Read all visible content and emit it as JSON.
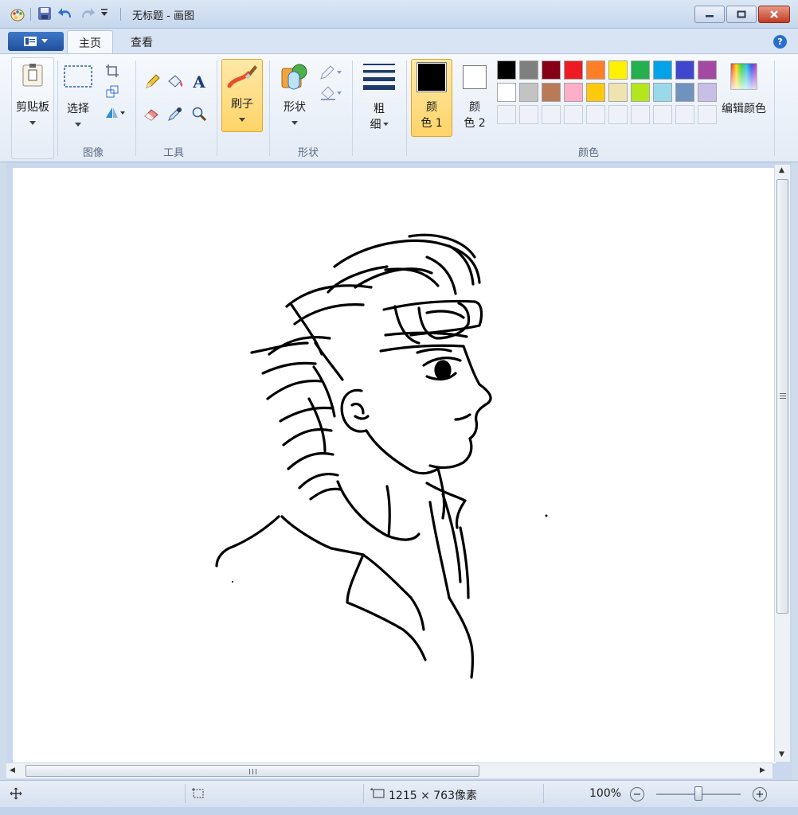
{
  "window": {
    "title": "无标题 - 画图",
    "colors": {
      "title_bg": "#c6d7ec",
      "close": "#c43b23",
      "accent": "#ffd468"
    }
  },
  "quick_access": {
    "icons": [
      "paint-app-icon",
      "save-icon",
      "undo-icon",
      "redo-icon",
      "customize-dropdown-icon"
    ]
  },
  "tabs": {
    "items": [
      {
        "label": "主页",
        "active": true
      },
      {
        "label": "查看",
        "active": false
      }
    ],
    "help": "?"
  },
  "ribbon": {
    "clipboard": {
      "label": "剪贴板"
    },
    "image": {
      "select_label": "选择",
      "group_label": "图像"
    },
    "tools": {
      "group_label": "工具",
      "text_glyph": "A"
    },
    "brush": {
      "label": "刷子"
    },
    "shapes": {
      "label": "形状",
      "group_label": "形状"
    },
    "size": {
      "label_line1": "粗",
      "label_line2": "细"
    },
    "color1": {
      "label_line1": "颜",
      "label_line2": "色 1",
      "value": "#000000"
    },
    "color2": {
      "label_line1": "颜",
      "label_line2": "色 2",
      "value": "#ffffff"
    },
    "colors": {
      "group_label": "颜色",
      "edit_label": "编辑颜色",
      "row1": [
        "#000000",
        "#7f7f7f",
        "#880015",
        "#ed1c24",
        "#ff7f27",
        "#fff200",
        "#22b14c",
        "#00a2e8",
        "#3f48cc",
        "#a349a4"
      ],
      "row2": [
        "#ffffff",
        "#c3c3c3",
        "#b97a57",
        "#ffaec9",
        "#ffc90e",
        "#efe4b0",
        "#b5e61d",
        "#99d9ea",
        "#7092be",
        "#c8bfe7"
      ]
    }
  },
  "statusbar": {
    "canvas_size": "1215 × 763像素",
    "zoom": "100%",
    "zoom_out": "−",
    "zoom_in": "+"
  }
}
